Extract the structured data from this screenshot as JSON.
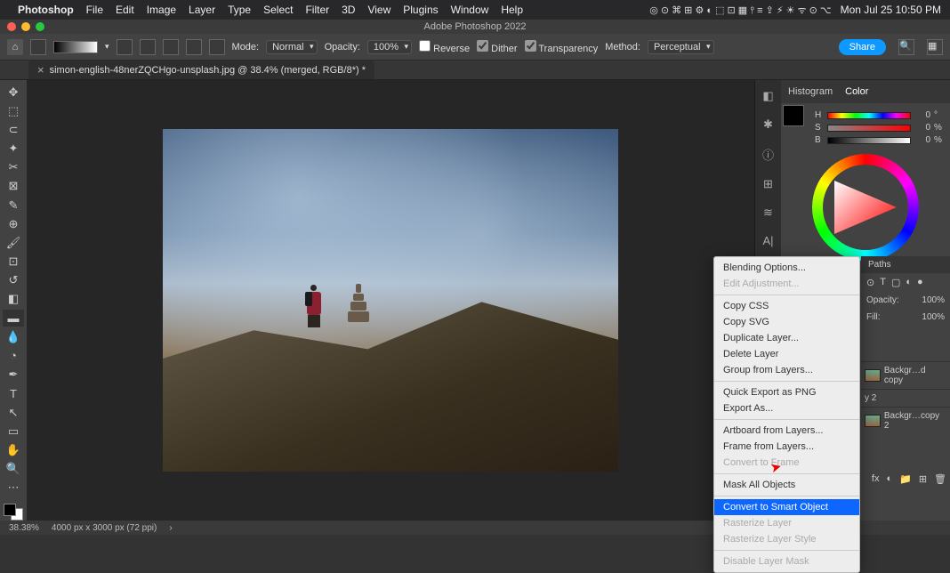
{
  "menubar": {
    "app": "Photoshop",
    "items": [
      "File",
      "Edit",
      "Image",
      "Layer",
      "Type",
      "Select",
      "Filter",
      "3D",
      "View",
      "Plugins",
      "Window",
      "Help"
    ],
    "clock": "Mon Jul 25  10:50 PM"
  },
  "window": {
    "title": "Adobe Photoshop 2022"
  },
  "options": {
    "mode_label": "Mode:",
    "mode": "Normal",
    "opacity_label": "Opacity:",
    "opacity": "100%",
    "reverse": "Reverse",
    "dither": "Dither",
    "transparency": "Transparency",
    "method_label": "Method:",
    "method": "Perceptual",
    "share": "Share"
  },
  "tab": {
    "title": "simon-english-48nerZQCHgo-unsplash.jpg @ 38.4% (merged, RGB/8*) *"
  },
  "panels": {
    "histogram": "Histogram",
    "color": "Color",
    "h": "H",
    "s": "S",
    "b": "B",
    "val": "0",
    "deg": "°",
    "pct": "%",
    "paths": "Paths",
    "opacity_label": "Opacity:",
    "opacity": "100%",
    "fill_label": "Fill:",
    "fill": "100%",
    "layer1": "Backgr…d copy",
    "layer2": "y 2",
    "layer3": "Backgr…copy 2"
  },
  "status": {
    "zoom": "38.38%",
    "dims": "4000 px x 3000 px (72 ppi)"
  },
  "context": {
    "blending": "Blending Options...",
    "edit_adj": "Edit Adjustment...",
    "copy_css": "Copy CSS",
    "copy_svg": "Copy SVG",
    "dup": "Duplicate Layer...",
    "del": "Delete Layer",
    "group": "Group from Layers...",
    "export_png": "Quick Export as PNG",
    "export_as": "Export As...",
    "artboard": "Artboard from Layers...",
    "frame": "Frame from Layers...",
    "conv_frame": "Convert to Frame",
    "mask_all": "Mask All Objects",
    "smart": "Convert to Smart Object",
    "rasterize": "Rasterize Layer",
    "rasterize_style": "Rasterize Layer Style",
    "disable_mask": "Disable Layer Mask"
  }
}
